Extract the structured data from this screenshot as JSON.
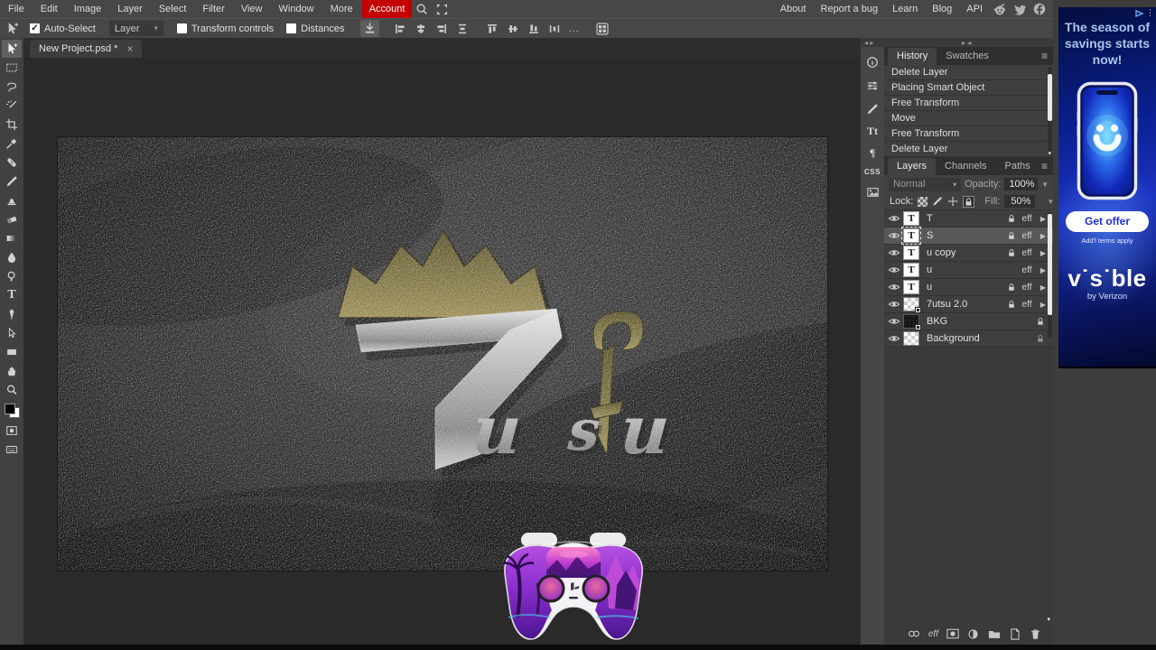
{
  "menubar": {
    "items": [
      "File",
      "Edit",
      "Image",
      "Layer",
      "Select",
      "Filter",
      "View",
      "Window",
      "More"
    ],
    "account": "Account",
    "right_items": [
      "About",
      "Report a bug",
      "Learn",
      "Blog",
      "API"
    ]
  },
  "optionsbar": {
    "auto_select": "Auto-Select",
    "layer_dropdown": "Layer",
    "transform_controls": "Transform controls",
    "distances": "Distances",
    "more": "..."
  },
  "tabbar": {
    "title": "New Project.psd *",
    "close": "×"
  },
  "history": {
    "tabs": [
      "History",
      "Swatches"
    ],
    "items": [
      "Delete Layer",
      "Placing Smart Object",
      "Free Transform",
      "Move",
      "Free Transform",
      "Delete Layer"
    ]
  },
  "layers_panel": {
    "tabs": [
      "Layers",
      "Channels",
      "Paths"
    ],
    "blend_mode": "Normal",
    "opacity_label": "Opacity:",
    "opacity_value": "100%",
    "lock_label": "Lock:",
    "fill_label": "Fill:",
    "fill_value": "50%",
    "eff_label": "eff",
    "rows": [
      {
        "name": "T"
      },
      {
        "name": "S"
      },
      {
        "name": "u copy"
      },
      {
        "name": "u"
      },
      {
        "name": "u"
      },
      {
        "name": "7utsu 2.0"
      },
      {
        "name": "BKG"
      },
      {
        "name": "Background"
      }
    ]
  },
  "canvas": {
    "logo_text": "7utsu",
    "logo_letters": [
      "u",
      "s",
      "u"
    ]
  },
  "ad": {
    "headline": "The season of savings starts now!",
    "cta": "Get offer",
    "terms": "Add'l terms apply",
    "brand": "v˙s˙ble",
    "brand_sub": "by Verizon"
  },
  "icons": {
    "check": "✓",
    "chevron_down": "▾",
    "dropdown": "▼",
    "hamburger": "≡",
    "expand": "▶",
    "collapse_left": "◂ ▸",
    "collapse_right": "▸ ◂",
    "kebab": "⋮",
    "scroll_down": "▾",
    "scroll_up": "▴",
    "text_layer_glyph": "T",
    "character": "Tt",
    "paragraph": "¶",
    "css": "CSS"
  },
  "colors": {
    "accent_red": "#c40000",
    "ad_blue": "#1b32c0",
    "cta_text": "#2030cf",
    "logo_gold": "#837748",
    "logo_silver": "#b9b9b9"
  }
}
